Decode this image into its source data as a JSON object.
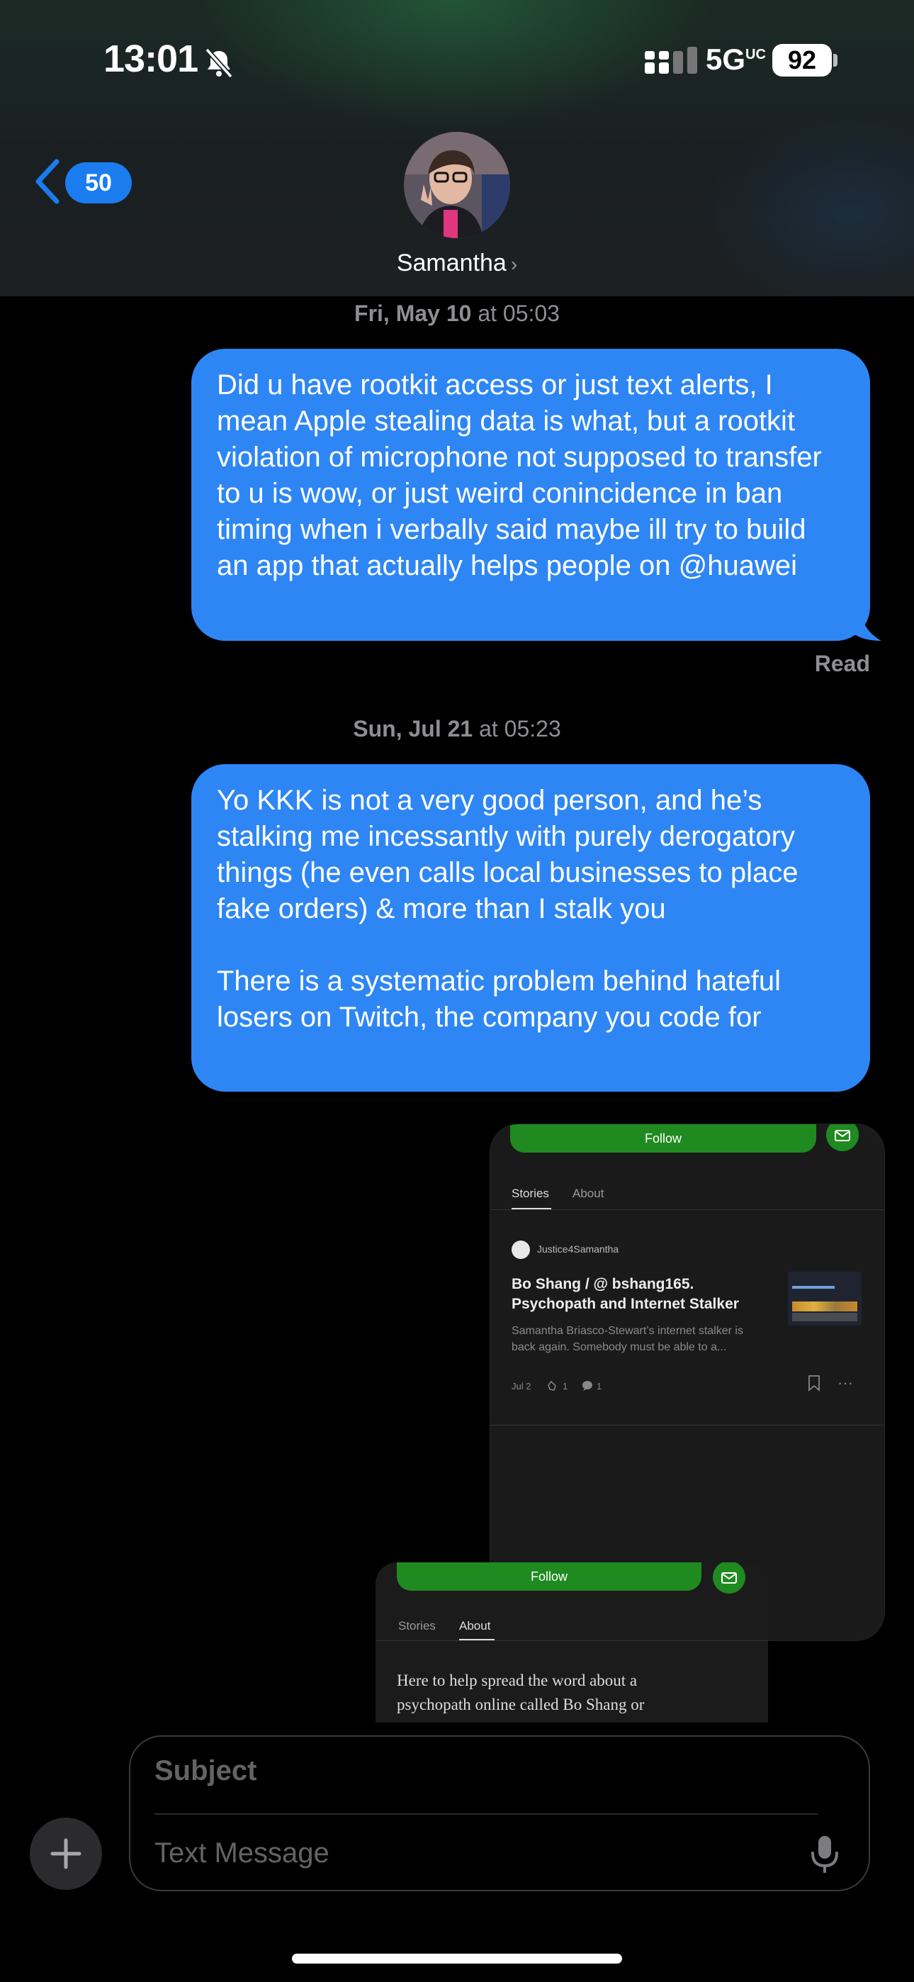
{
  "status_bar": {
    "time": "13:01",
    "network": "5G",
    "network_suffix": "UC",
    "battery": "92",
    "icons": [
      "bell-slash-icon",
      "signal-bars-icon"
    ]
  },
  "nav": {
    "back_count": "50",
    "contact_name": "Samantha",
    "chevron": "›"
  },
  "messages": [
    {
      "timestamp_day": "Fri, May 10",
      "timestamp_time": " at 05:03",
      "text": "Did u have rootkit access or just text alerts, I mean Apple stealing data is what, but a rootkit violation of microphone not supposed to transfer to u is wow, or just weird conincidence in ban timing when i verbally said maybe ill try to build an app that actually helps people on @huawei",
      "status": "Read"
    },
    {
      "timestamp_day": "Sun, Jul 21",
      "timestamp_time": " at 05:23",
      "text": "Yo KKK is not a very good person, and he’s stalking me incessantly with purely derogatory things (he even calls local businesses to place fake orders) & more than I stalk you\n\nThere is a systematic problem behind hateful losers on Twitch, the company you code for"
    }
  ],
  "attachment1": {
    "follow_label": "Follow",
    "tabs": [
      "Stories",
      "About"
    ],
    "active_tab": "Stories",
    "author": "Justice4Samantha",
    "article_title": "Bo Shang / @ bshang165. Psychopath and Internet Stalker",
    "article_excerpt": "Samantha Briasco-Stewart’s internet stalker is back again. Somebody must be able to a...",
    "date": "Jul 2",
    "claps": "1",
    "comments": "1"
  },
  "attachment2": {
    "follow_label": "Follow",
    "tabs": [
      "Stories",
      "About"
    ],
    "active_tab": "About",
    "about_line1": "Here to help spread the word about a",
    "about_line2": "psychopath online called Bo Shang or"
  },
  "compose": {
    "subject_placeholder": "Subject",
    "message_placeholder": "Text Message"
  },
  "colors": {
    "bubble": "#2e86f5",
    "follow_green": "#1f8a1f",
    "badge_blue": "#1b7cf0"
  }
}
